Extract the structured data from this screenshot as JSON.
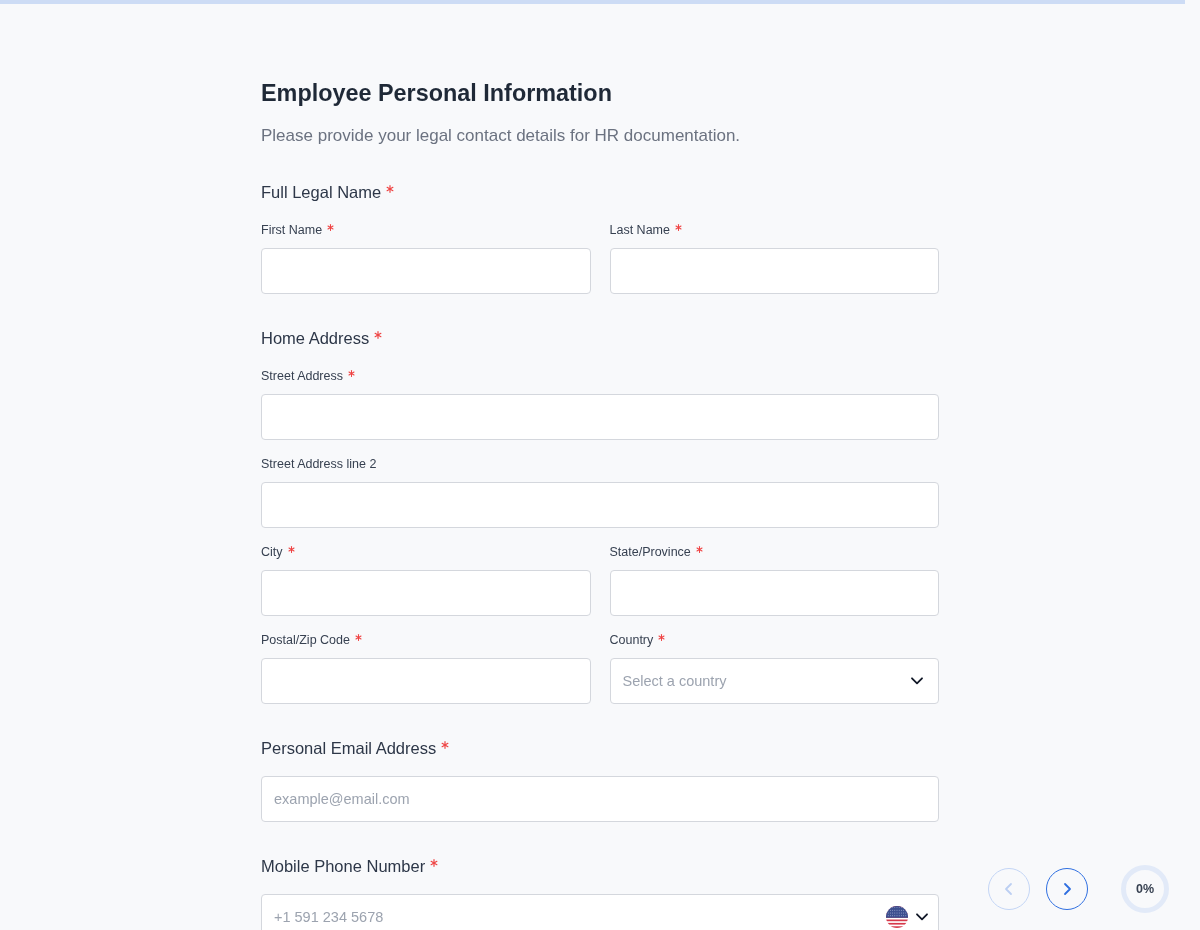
{
  "form": {
    "title": "Employee Personal Information",
    "subtitle": "Please provide your legal contact details for HR documentation.",
    "sections": [
      {
        "label": "Full Legal Name",
        "required": true,
        "rows": [
          {
            "fields": [
              {
                "kind": "text",
                "label": "First Name",
                "required": true
              },
              {
                "kind": "text",
                "label": "Last Name",
                "required": true
              }
            ]
          }
        ]
      },
      {
        "label": "Home Address",
        "required": true,
        "rows": [
          {
            "fields": [
              {
                "kind": "text",
                "label": "Street Address",
                "required": true
              }
            ]
          },
          {
            "fields": [
              {
                "kind": "text",
                "label": "Street Address line 2",
                "required": false
              }
            ]
          },
          {
            "fields": [
              {
                "kind": "text",
                "label": "City",
                "required": true
              },
              {
                "kind": "text",
                "label": "State/Province",
                "required": true
              }
            ]
          },
          {
            "fields": [
              {
                "kind": "text",
                "label": "Postal/Zip Code",
                "required": true
              },
              {
                "kind": "select",
                "label": "Country",
                "required": true,
                "placeholder": "Select a country"
              }
            ]
          }
        ]
      },
      {
        "label": "Personal Email Address",
        "required": true,
        "rows": [
          {
            "fields": [
              {
                "kind": "email",
                "placeholder": "example@email.com"
              }
            ]
          }
        ]
      },
      {
        "label": "Mobile Phone Number",
        "required": true,
        "rows": [
          {
            "fields": [
              {
                "kind": "phone",
                "placeholder": "+1 591 234 5678"
              }
            ]
          }
        ]
      }
    ]
  },
  "navigation": [
    {
      "kind": "previous",
      "disabled": true
    },
    {
      "kind": "next",
      "disabled": false
    }
  ],
  "progress": {
    "reading": "0%"
  }
}
